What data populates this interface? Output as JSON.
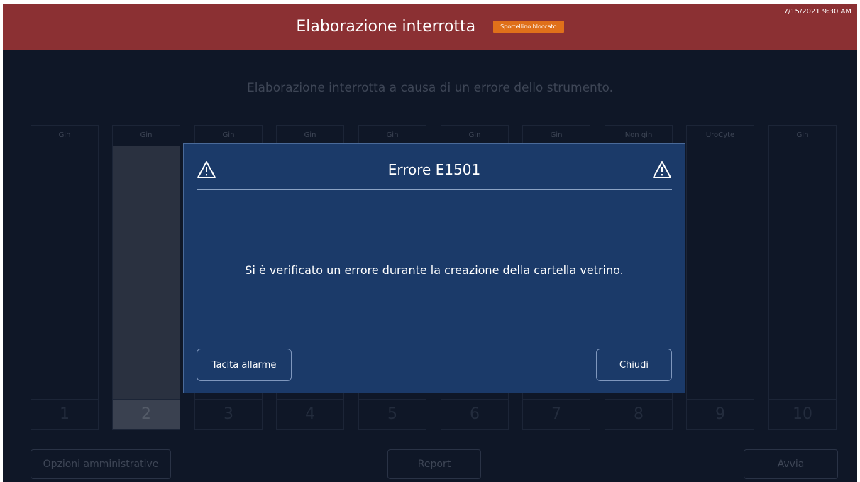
{
  "header": {
    "title": "Elaborazione interrotta",
    "badge": "Sportellino bloccato",
    "datetime": "7/15/2021 9:30 AM"
  },
  "main": {
    "message": "Elaborazione interrotta a causa di un errore dello strumento.",
    "slots": [
      {
        "label": "Gin",
        "number": "1"
      },
      {
        "label": "Gin",
        "number": "2"
      },
      {
        "label": "Gin",
        "number": "3"
      },
      {
        "label": "Gin",
        "number": "4"
      },
      {
        "label": "Gin",
        "number": "5"
      },
      {
        "label": "Gin",
        "number": "6"
      },
      {
        "label": "Gin",
        "number": "7"
      },
      {
        "label": "Non gin",
        "number": "8"
      },
      {
        "label": "UroCyte",
        "number": "9"
      },
      {
        "label": "Gin",
        "number": "10"
      }
    ]
  },
  "footer": {
    "admin_label": "Opzioni amministrative",
    "report_label": "Report",
    "start_label": "Avvia"
  },
  "dialog": {
    "title": "Errore E1501",
    "message": "Si è verificato un errore durante la creazione della cartella vetrino.",
    "silence_label": "Tacita allarme",
    "close_label": "Chiudi"
  },
  "icons": {
    "warning": "warning-triangle-icon"
  },
  "colors": {
    "header_bg": "#8b3033",
    "badge_bg": "#e0701a",
    "screen_bg": "#0f1727",
    "dialog_bg": "#1b3a69"
  }
}
